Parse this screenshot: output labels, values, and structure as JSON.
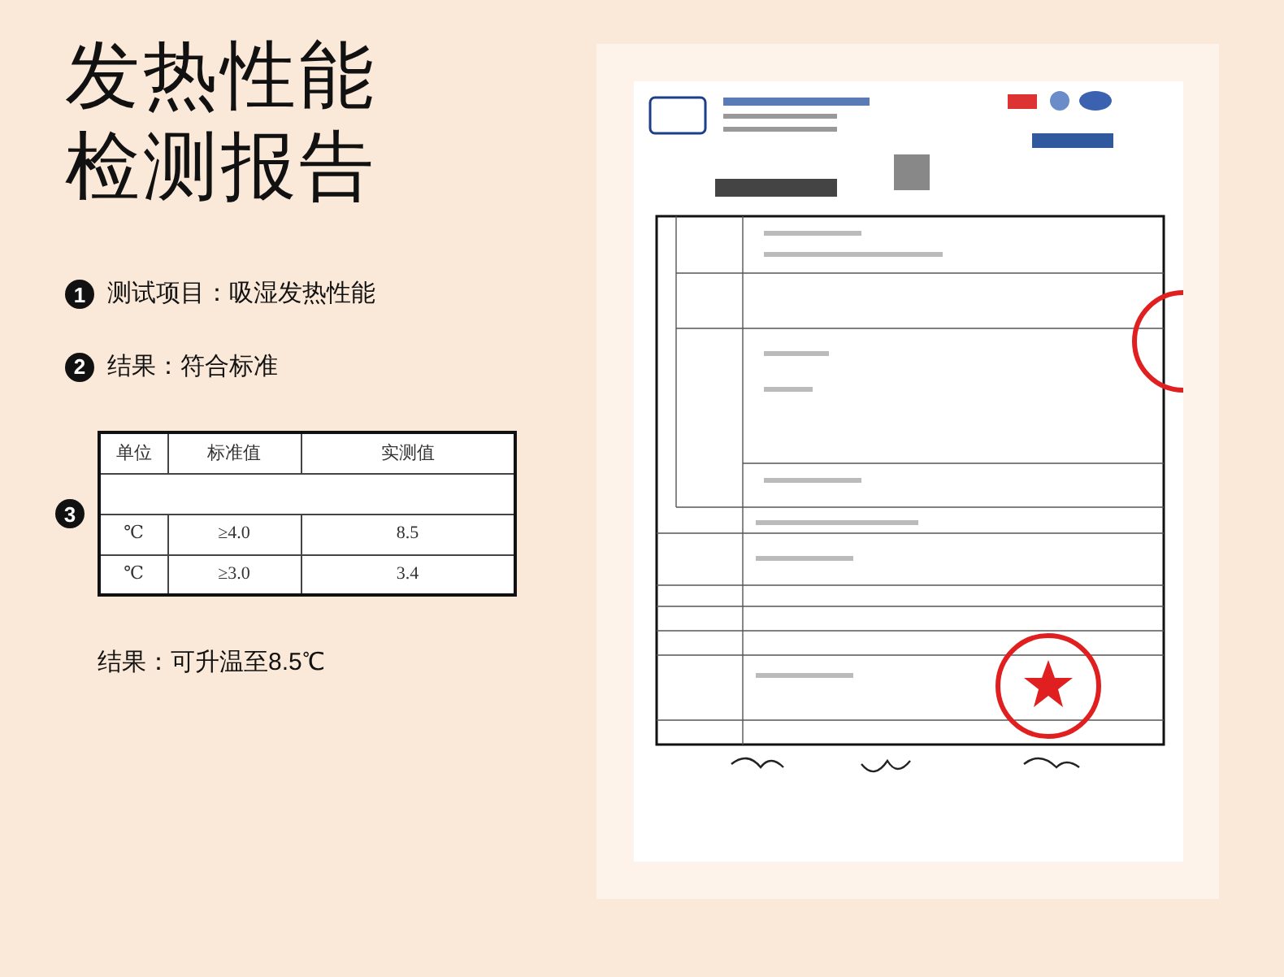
{
  "title": [
    "发热性能",
    "检测报告"
  ],
  "items": [
    {
      "number": "1",
      "text": "测试项目：吸湿发热性能"
    },
    {
      "number": "2",
      "text": "结果：符合标准"
    }
  ],
  "table": {
    "number": "3",
    "columns": [
      "单位",
      "标准值",
      "实测值"
    ],
    "rows": [
      [
        "℃",
        "≥4.0",
        "8.5"
      ],
      [
        "℃",
        "≥3.0",
        "3.4"
      ]
    ]
  },
  "result": "结果：可升温至8.5℃"
}
